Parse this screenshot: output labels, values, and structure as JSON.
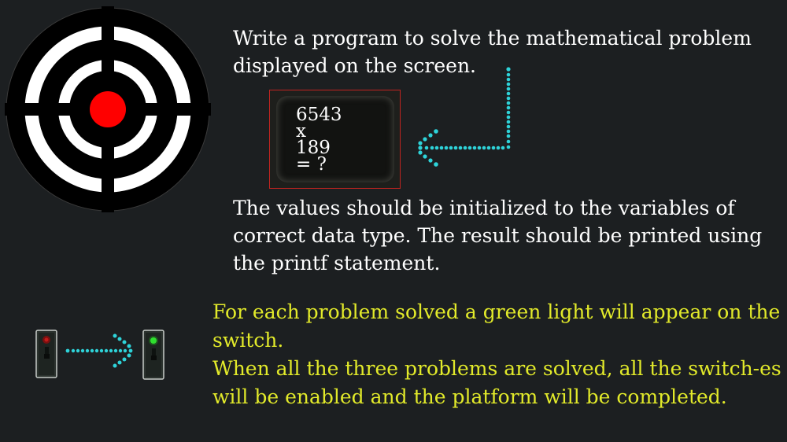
{
  "instructions": {
    "intro": "Write a program to solve the mathematical problem displayed on the screen.",
    "details": "The values should be initialized to the variables of correct data type. The result should be printed using the printf statement."
  },
  "problem": {
    "line1": "6543",
    "line2": "x",
    "line3": "189",
    "line4": "= ?"
  },
  "hints": {
    "green_light": "For each problem solved a green light will appear on the switch.",
    "completion": "When all the three problems are solved, all the switch-es will be enabled and the platform will be completed."
  },
  "switches": {
    "before_light": "red",
    "after_light": "green"
  },
  "colors": {
    "background": "#1c1f21",
    "text_white": "#ffffff",
    "text_yellow": "#e2ea2a",
    "arrow_dots": "#2ed3d9",
    "target_red": "#ff0000",
    "board_border": "#c02420"
  }
}
